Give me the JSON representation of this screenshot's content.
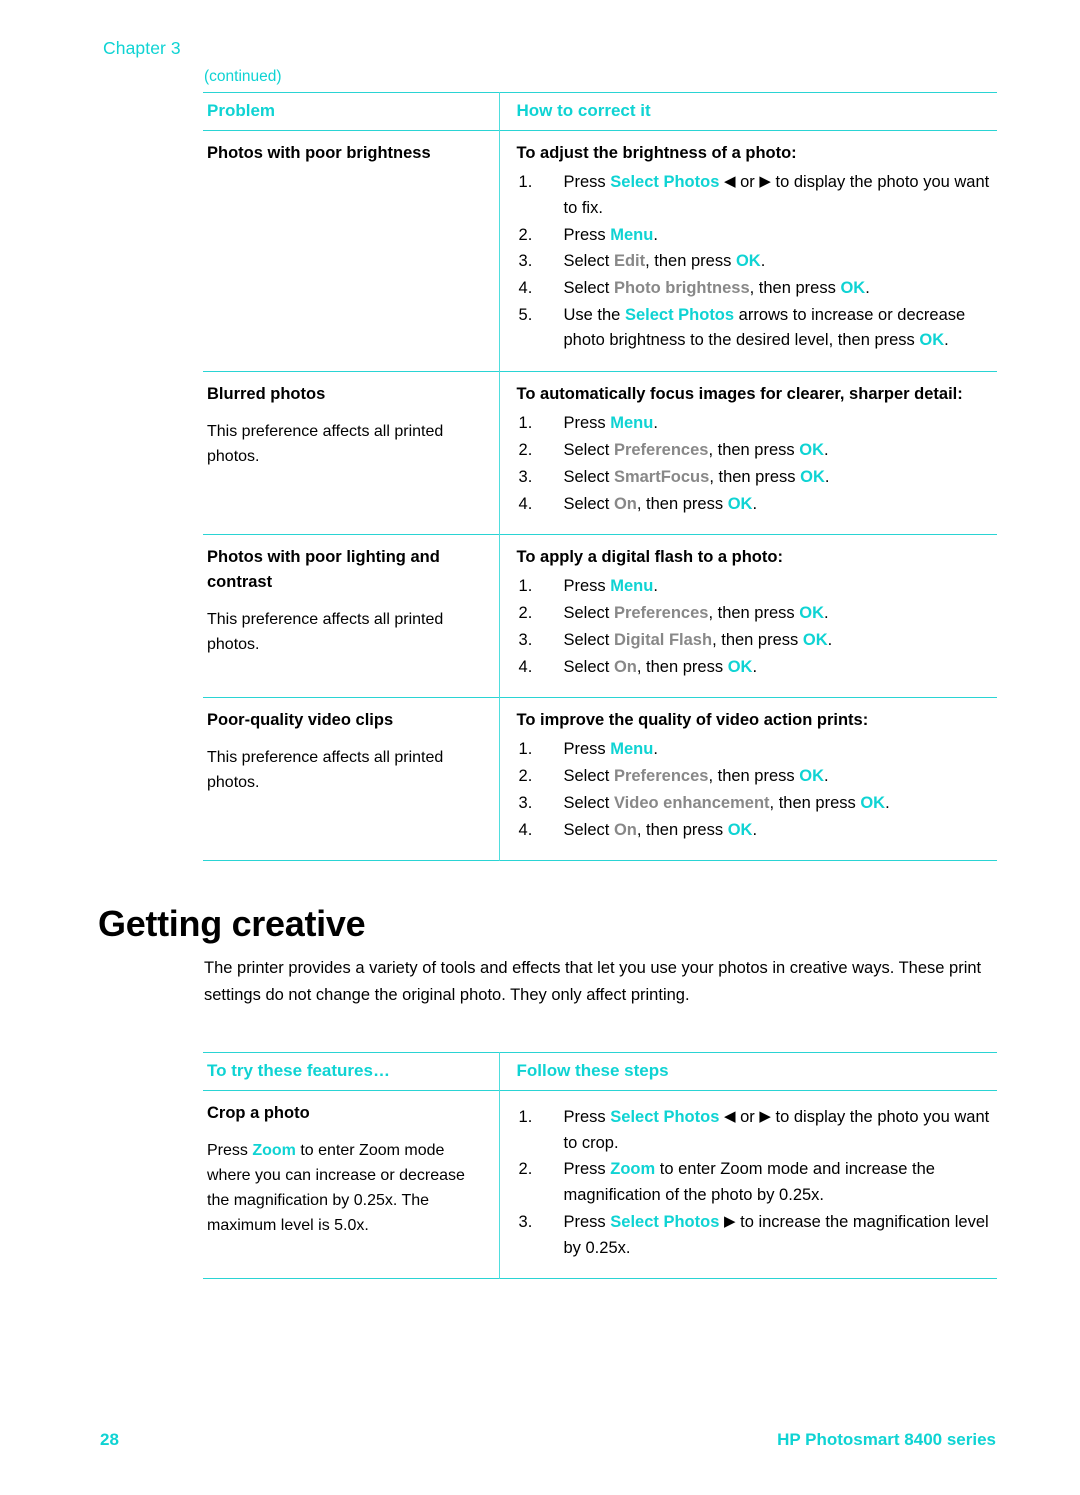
{
  "header": {
    "chapter": "Chapter 3",
    "continued": "(continued)"
  },
  "tables": [
    {
      "id": "problems",
      "headers": [
        "Problem",
        "How to correct it"
      ],
      "rows": [
        {
          "left_title": "Photos with poor brightness",
          "left_note": "",
          "right_title": "To adjust the brightness of a photo:",
          "steps": [
            "Press Select Photos ◀ or ▶ to display the photo you want to fix.",
            "Press Menu.",
            "Select Edit, then press OK.",
            "Select Photo brightness, then press OK.",
            "Use the Select Photos arrows to increase or decrease photo brightness to the desired level, then press OK."
          ]
        },
        {
          "left_title": "Blurred photos",
          "left_note": "This preference affects all printed photos.",
          "right_title": "To automatically focus images for clearer, sharper detail:",
          "steps": [
            "Press Menu.",
            "Select Preferences, then press OK.",
            "Select SmartFocus, then press OK.",
            "Select On, then press OK."
          ]
        },
        {
          "left_title": "Photos with poor lighting and contrast",
          "left_note": "This preference affects all printed photos.",
          "right_title": "To apply a digital flash to a photo:",
          "steps": [
            "Press Menu.",
            "Select Preferences, then press OK.",
            "Select Digital Flash, then press OK.",
            "Select On, then press OK."
          ]
        },
        {
          "left_title": "Poor-quality video clips",
          "left_note": "This preference affects all printed photos.",
          "right_title": "To improve the quality of video action prints:",
          "steps": [
            "Press Menu.",
            "Select Preferences, then press OK.",
            "Select Video enhancement, then press OK.",
            "Select On, then press OK."
          ]
        }
      ]
    },
    {
      "id": "creative",
      "headers": [
        "To try these features…",
        "Follow these steps"
      ],
      "rows": [
        {
          "left_title": "Crop a photo",
          "left_note": "Press Zoom to enter Zoom mode where you can increase or decrease the magnification by 0.25x. The maximum level is 5.0x.",
          "right_title": "",
          "steps": [
            "Press Select Photos ◀ or ▶ to display the photo you want to crop.",
            "Press Zoom to enter Zoom mode and increase the magnification of the photo by 0.25x.",
            "Press Select Photos ▶ to increase the magnification level by 0.25x."
          ]
        }
      ]
    }
  ],
  "section": {
    "heading": "Getting creative",
    "body": "The printer provides a variety of tools and effects that let you use your photos in creative ways. These print settings do not change the original photo. They only affect printing."
  },
  "footer": {
    "page_number": "28",
    "product": "HP Photosmart 8400 series"
  },
  "colors": {
    "accent_cyan": "#0fd3d3",
    "rule_cyan": "#2ad4d4",
    "menu_item_gray": "#888888",
    "text_black": "#000000"
  },
  "icons": {
    "arrow_left": "◀",
    "arrow_right": "▶"
  }
}
